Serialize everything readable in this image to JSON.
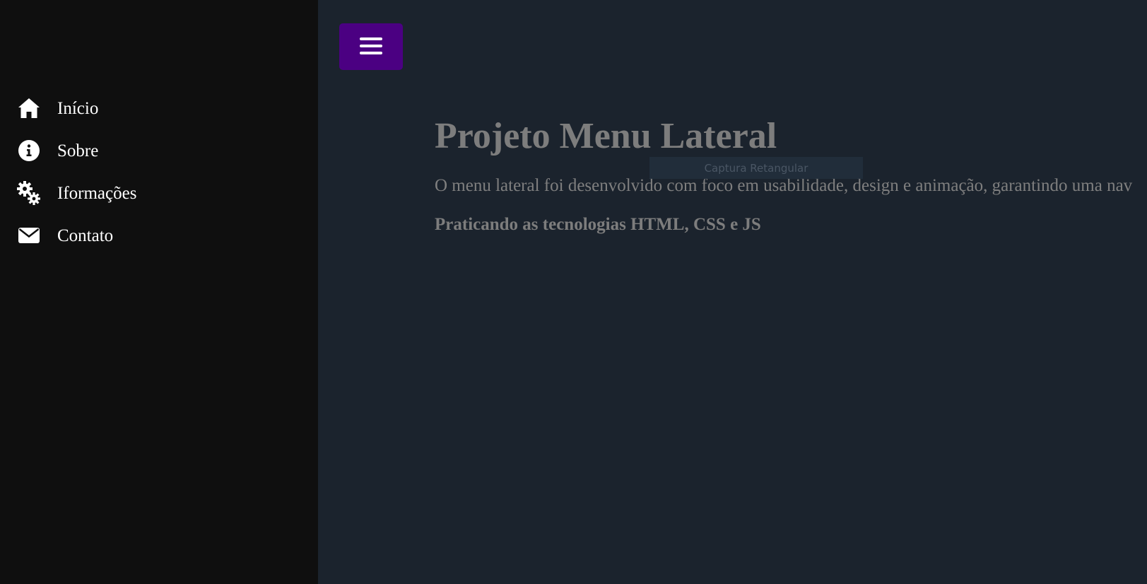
{
  "sidebar": {
    "items": [
      {
        "label": "Início",
        "icon": "home-icon"
      },
      {
        "label": "Sobre",
        "icon": "info-icon"
      },
      {
        "label": "Iformações",
        "icon": "gears-icon"
      },
      {
        "label": "Contato",
        "icon": "envelope-icon"
      }
    ]
  },
  "menu_button": {
    "icon": "hamburger-icon",
    "color": "#4b0082"
  },
  "main": {
    "title": "Projeto Menu Lateral",
    "description": "O menu lateral foi desenvolvido com foco em usabilidade, design e animação, garantindo uma nav",
    "subtitle": "Praticando as tecnologias HTML, CSS e JS"
  },
  "overlay": {
    "label": "Captura Retangular"
  },
  "colors": {
    "sidebar_bg": "#0f0f0f",
    "main_bg": "#1b232d",
    "accent": "#4b0082",
    "text_muted": "#7d7d7d"
  }
}
